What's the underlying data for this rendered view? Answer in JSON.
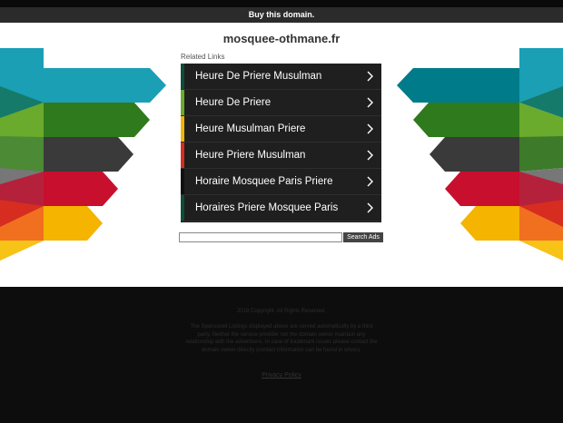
{
  "topbar": {
    "buy_label": "Buy this domain."
  },
  "domain": "mosquee-othmane.fr",
  "related_label": "Related Links",
  "links": [
    {
      "label": "Heure De Priere Musulman",
      "color": "#0e4d3a"
    },
    {
      "label": "Heure De Priere",
      "color": "#6aaa2c"
    },
    {
      "label": "Heure Musulman Priere",
      "color": "#f0b400"
    },
    {
      "label": "Heure Priere Musulman",
      "color": "#d62d20"
    },
    {
      "label": "Horaire Mosquee Paris Priere",
      "color": "#111111"
    },
    {
      "label": "Horaires Priere Mosquee Paris",
      "color": "#0e4d3a"
    }
  ],
  "search": {
    "button_label": "Search Ads",
    "value": ""
  },
  "decor_colors": [
    "#1a9fb5",
    "#1a8a6a",
    "#6aaa2c",
    "#3d7a2a",
    "#444444",
    "#b5213b",
    "#d62d20",
    "#f07020",
    "#f0b400"
  ],
  "footer": {
    "copyright": "2018 Copyright. All Rights Reserved.",
    "disclaimer": "The Sponsored Listings displayed above are served automatically by a third party. Neither the service provider nor the domain owner maintain any relationship with the advertisers. In case of trademark issues please contact the domain owner directly (contact information can be found in whois).",
    "privacy": "Privacy Policy"
  }
}
